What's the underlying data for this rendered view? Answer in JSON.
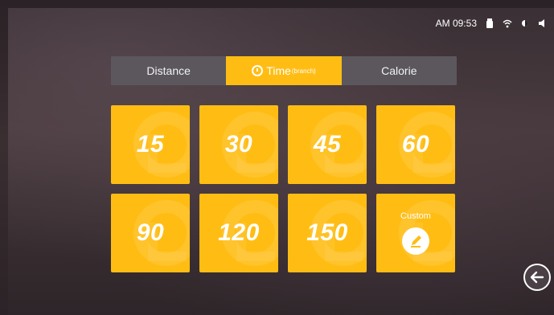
{
  "status_bar": {
    "time": "AM 09:53",
    "icons": [
      "usb-icon",
      "wifi-icon",
      "brightness-icon",
      "volume-icon"
    ]
  },
  "tabs": [
    {
      "label": "Distance",
      "sub": "",
      "active": false
    },
    {
      "label": "Time",
      "sub": "(branch)",
      "active": true
    },
    {
      "label": "Calorie",
      "sub": "",
      "active": false
    }
  ],
  "presets": [
    "15",
    "30",
    "45",
    "60",
    "90",
    "120",
    "150"
  ],
  "custom": {
    "label": "Custom"
  },
  "colors": {
    "accent": "#ffbd14",
    "tab_bar": "#5b575d"
  }
}
